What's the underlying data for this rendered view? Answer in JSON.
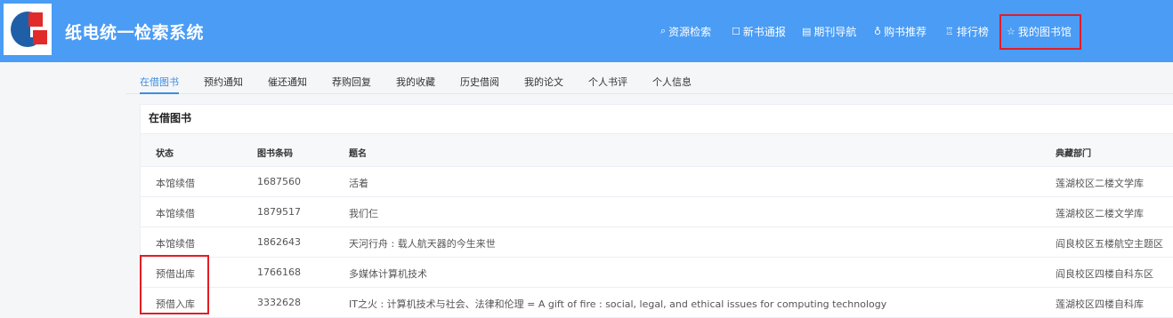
{
  "header": {
    "brand": "纸电统一检索系统",
    "nav": [
      {
        "icon": "search-icon",
        "glyph": "⌕",
        "label": "资源检索"
      },
      {
        "icon": "new-book-icon",
        "glyph": "☐",
        "label": "新书通报"
      },
      {
        "icon": "journal-icon",
        "glyph": "▤",
        "label": "期刊导航"
      },
      {
        "icon": "recommend-icon",
        "glyph": "♁",
        "label": "购书推荐"
      },
      {
        "icon": "ranking-icon",
        "glyph": "♖",
        "label": "排行榜"
      },
      {
        "icon": "star-icon",
        "glyph": "☆",
        "label": "我的图书馆"
      }
    ]
  },
  "tabs": [
    "在借图书",
    "预约通知",
    "催还通知",
    "荐购回复",
    "我的收藏",
    "历史借阅",
    "我的论文",
    "个人书评",
    "个人信息"
  ],
  "active_tab": "在借图书",
  "panel": {
    "title": "在借图书",
    "columns": {
      "status": "状态",
      "barcode": "图书条码",
      "title": "题名",
      "location": "典藏部门"
    },
    "rows": [
      {
        "status": "本馆续借",
        "barcode": "1687560",
        "title": "活着",
        "location": "莲湖校区二楼文学库"
      },
      {
        "status": "本馆续借",
        "barcode": "1879517",
        "title": "我们仨",
        "location": "莲湖校区二楼文学库"
      },
      {
        "status": "本馆续借",
        "barcode": "1862643",
        "title": "天河行舟 : 载人航天器的今生来世",
        "location": "阎良校区五楼航空主题区"
      },
      {
        "status": "预借出库",
        "barcode": "1766168",
        "title": "多媒体计算机技术",
        "location": "阎良校区四楼自科东区"
      },
      {
        "status": "预借入库",
        "barcode": "3332628",
        "title": "IT之火 : 计算机技术与社会、法律和伦理 = A gift of fire : social, legal, and ethical issues for computing technology",
        "location": "莲湖校区四楼自科库"
      }
    ]
  },
  "colors": {
    "header_bg": "#4a9cf5",
    "active_tab": "#3a8ee6",
    "highlight_box": "#e51c23"
  }
}
